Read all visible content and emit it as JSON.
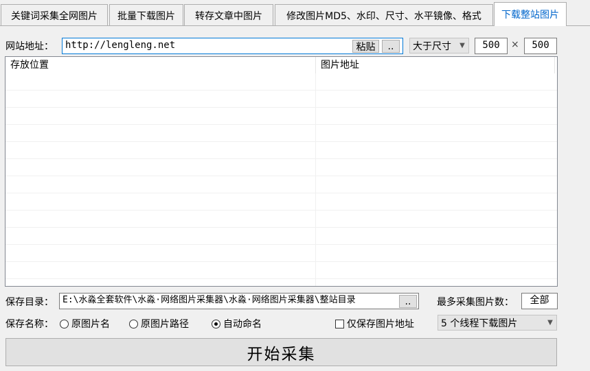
{
  "tabs": [
    {
      "label": "关键词采集全网图片"
    },
    {
      "label": "批量下载图片"
    },
    {
      "label": "转存文章中图片"
    },
    {
      "label": "修改图片MD5、水印、尺寸、水平镜像、格式"
    },
    {
      "label": "下载整站图片"
    }
  ],
  "site": {
    "label": "网站地址：",
    "url": "http://lengleng.net",
    "paste_label": "粘贴",
    "browse_label": ".."
  },
  "size_filter": {
    "selected": "大于尺寸",
    "width": "500",
    "times": "×",
    "height": "500"
  },
  "table": {
    "columns": [
      "存放位置",
      "图片地址"
    ],
    "rows": []
  },
  "save_dir": {
    "label": "保存目录：",
    "value": "E:\\水淼全套软件\\水淼·网络图片采集器\\水淼·网络图片采集器\\整站目录",
    "browse_label": ".."
  },
  "max_count": {
    "label": "最多采集图片数：",
    "value": "全部"
  },
  "save_name": {
    "label": "保存名称：",
    "options": [
      {
        "label": "原图片名",
        "checked": false
      },
      {
        "label": "原图片路径",
        "checked": false
      },
      {
        "label": "自动命名",
        "checked": true
      }
    ]
  },
  "only_url": {
    "label": "仅保存图片地址",
    "checked": false
  },
  "threads": {
    "selected": "5 个线程下载图片"
  },
  "start_label": "开始采集"
}
